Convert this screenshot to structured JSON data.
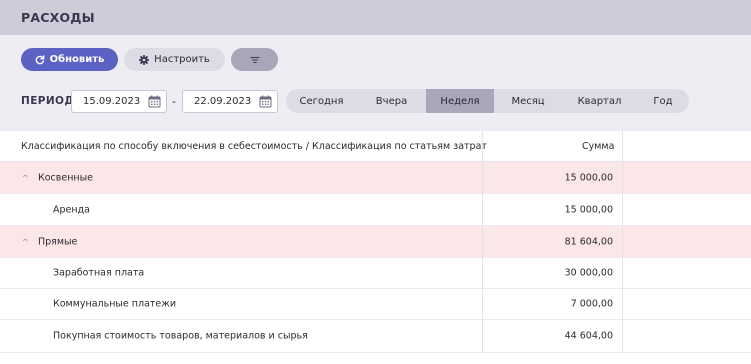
{
  "header": {
    "title": "РАСХОДЫ"
  },
  "toolbar": {
    "refresh_label": "Обновить",
    "settings_label": "Настроить"
  },
  "period": {
    "label": "ПЕРИОД",
    "date_from": "15.09.2023",
    "date_to": "22.09.2023",
    "separator": "-",
    "ranges": [
      "Сегодня",
      "Вчера",
      "Неделя",
      "Месяц",
      "Квартал",
      "Год"
    ],
    "active_range": "Неделя"
  },
  "table": {
    "columns": [
      "Классификация по способу включения в себестоимость / Классификация по статьям затрат",
      "Сумма"
    ],
    "rows": [
      {
        "type": "group",
        "label": "Косвенные",
        "amount": "15 000,00"
      },
      {
        "type": "item",
        "label": "Аренда",
        "amount": "15 000,00"
      },
      {
        "type": "group",
        "label": "Прямые",
        "amount": "81 604,00"
      },
      {
        "type": "item",
        "label": "Заработная плата",
        "amount": "30 000,00"
      },
      {
        "type": "item",
        "label": "Коммунальные платежи",
        "amount": "7 000,00"
      },
      {
        "type": "item",
        "label": "Покупная стоимость товаров, материалов и сырья",
        "amount": "44 604,00"
      }
    ]
  },
  "colors": {
    "accent": "#5b62c4",
    "group_row": "#fbe6e8",
    "titlebar": "#ceccd8",
    "segment_active": "#a8a6b8"
  }
}
